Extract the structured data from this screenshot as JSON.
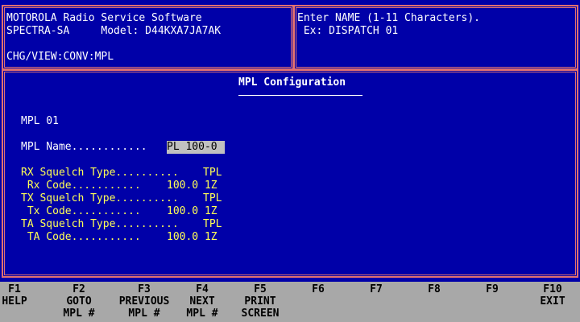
{
  "header": {
    "app_title": "MOTOROLA Radio Service Software",
    "radio_line": "SPECTRA-SA     Model: D44KXA7JA7AK",
    "path": "CHG/VIEW:CONV:MPL",
    "hint_line1": "Enter NAME (1-11 Characters).",
    "hint_line2": " Ex: DISPATCH 01"
  },
  "main": {
    "title": "MPL Configuration",
    "mpl_id": "MPL 01",
    "name_label": "MPL Name............",
    "name_value": "PL 100-0",
    "rx_squelch_label": "RX Squelch Type..........",
    "rx_squelch_value": "TPL",
    "rx_code_label": " Rx Code...........",
    "rx_code_value": "100.0 1Z",
    "tx_squelch_label": "TX Squelch Type..........",
    "tx_squelch_value": "TPL",
    "tx_code_label": " Tx Code...........",
    "tx_code_value": "100.0 1Z",
    "ta_squelch_label": "TA Squelch Type..........",
    "ta_squelch_value": "TPL",
    "ta_code_label": " TA Code...........",
    "ta_code_value": "100.0 1Z"
  },
  "function_keys": [
    {
      "key": "F1",
      "line1": "HELP",
      "line2": ""
    },
    {
      "key": "F2",
      "line1": "GOTO",
      "line2": "MPL #"
    },
    {
      "key": "F3",
      "line1": "PREVIOUS",
      "line2": "MPL #"
    },
    {
      "key": "F4",
      "line1": "NEXT",
      "line2": "MPL #"
    },
    {
      "key": "F5",
      "line1": "PRINT",
      "line2": "SCREEN"
    },
    {
      "key": "F6",
      "line1": "",
      "line2": ""
    },
    {
      "key": "F7",
      "line1": "",
      "line2": ""
    },
    {
      "key": "F8",
      "line1": "",
      "line2": ""
    },
    {
      "key": "F9",
      "line1": "",
      "line2": ""
    },
    {
      "key": "F10",
      "line1": "EXIT",
      "line2": ""
    }
  ],
  "colors": {
    "background": "#0000a8",
    "border": "#e07070",
    "label_yellow": "#ffff55",
    "function_bar": "#a8a8a8"
  }
}
